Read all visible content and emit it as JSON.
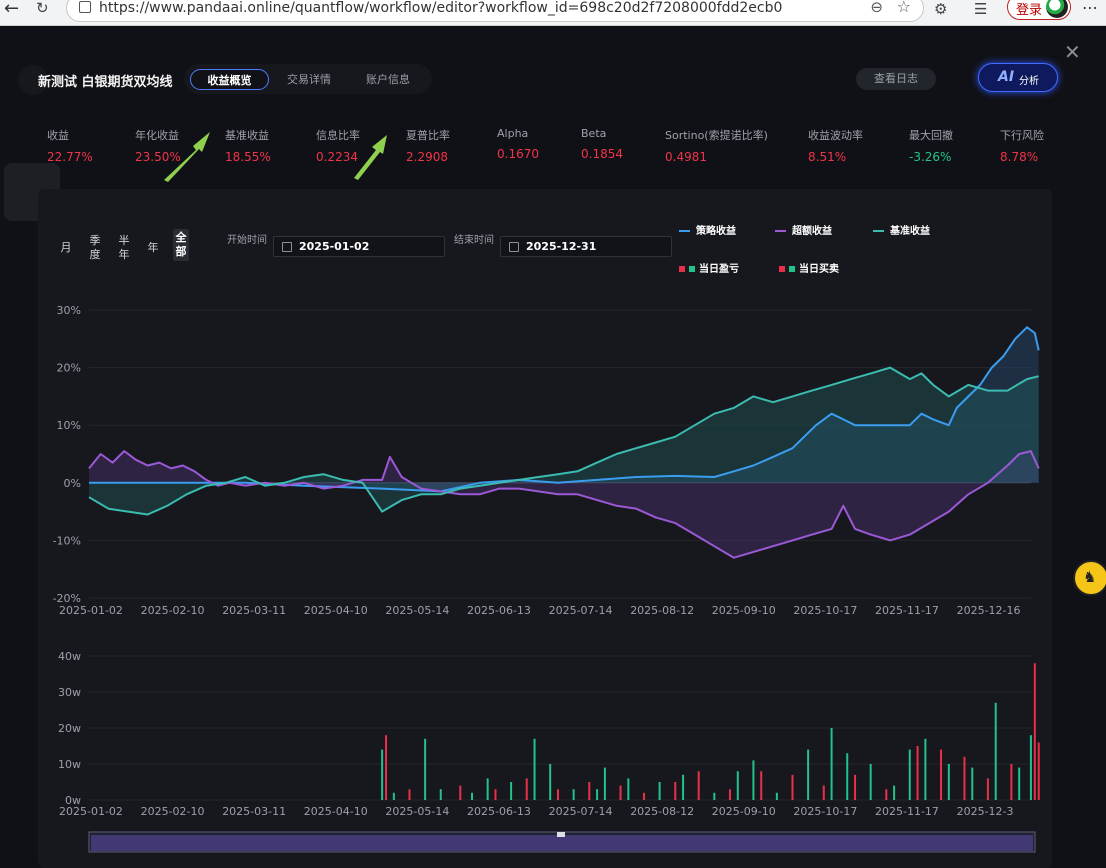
{
  "browser": {
    "url": "https://www.pandaai.online/quantflow/workflow/editor?workflow_id=698c20d2f7208000fdd2ecb0",
    "login_label": "登录"
  },
  "header": {
    "title": "新测试 白银期货双均线",
    "tabs": [
      "收益概览",
      "交易详情",
      "账户信息"
    ],
    "active_tab": "收益概览",
    "log_button": "查看日志",
    "ai_badge": "AI",
    "ai_button": "分析"
  },
  "metrics": [
    {
      "label": "收益",
      "value": "22.77%",
      "color": "#f0344a"
    },
    {
      "label": "年化收益",
      "value": "23.50%",
      "color": "#f0344a"
    },
    {
      "label": "基准收益",
      "value": "18.55%",
      "color": "#f0344a"
    },
    {
      "label": "信息比率",
      "value": "0.2234",
      "color": "#f0344a"
    },
    {
      "label": "夏普比率",
      "value": "2.2908",
      "color": "#f0344a"
    },
    {
      "label": "Alpha",
      "value": "0.1670",
      "color": "#f0344a"
    },
    {
      "label": "Beta",
      "value": "0.1854",
      "color": "#f0344a"
    },
    {
      "label": "Sortino(索提诺比率)",
      "value": "0.4981",
      "color": "#f0344a"
    },
    {
      "label": "收益波动率",
      "value": "8.51%",
      "color": "#f0344a"
    },
    {
      "label": "最大回撤",
      "value": "-3.26%",
      "color": "#26c488"
    },
    {
      "label": "下行风险",
      "value": "8.78%",
      "color": "#f0344a"
    }
  ],
  "filters": {
    "periods": [
      "月",
      "季度",
      "半年",
      "年",
      "全部"
    ],
    "active_period": "全部",
    "start_label": "开始时间",
    "start_value": "2025-01-02",
    "end_label": "结束时间",
    "end_value": "2025-12-31"
  },
  "legend": {
    "strategy": {
      "label": "策略收益",
      "color": "#3a9df0"
    },
    "excess": {
      "label": "超额收益",
      "color": "#9b59d6"
    },
    "benchmark": {
      "label": "基准收益",
      "color": "#3bbcb0"
    },
    "daily_pnl": {
      "label": "当日盈亏"
    },
    "daily_trade": {
      "label": "当日买卖"
    },
    "up_color": "#e8304a",
    "down_color": "#22c28a"
  },
  "chart_data": [
    {
      "type": "line",
      "x_ticks": [
        "2025-01-02",
        "2025-02-10",
        "2025-03-11",
        "2025-04-10",
        "2025-05-14",
        "2025-06-13",
        "2025-07-14",
        "2025-08-12",
        "2025-09-10",
        "2025-10-17",
        "2025-11-17",
        "2025-12-16"
      ],
      "y_ticks": [
        "30%",
        "20%",
        "10%",
        "0%",
        "-10%",
        "-20%"
      ],
      "ylim": [
        -20,
        30
      ],
      "x_index_range": [
        0,
        240
      ],
      "series": [
        {
          "name": "策略收益",
          "color": "#3a9df0",
          "points": [
            [
              0,
              0
            ],
            [
              40,
              0
            ],
            [
              55,
              -0.5
            ],
            [
              75,
              -1
            ],
            [
              90,
              -1.5
            ],
            [
              100,
              0
            ],
            [
              110,
              0.5
            ],
            [
              120,
              0
            ],
            [
              130,
              0.5
            ],
            [
              140,
              1
            ],
            [
              150,
              1.2
            ],
            [
              160,
              1
            ],
            [
              165,
              2
            ],
            [
              170,
              3
            ],
            [
              175,
              4.5
            ],
            [
              180,
              6
            ],
            [
              183,
              8
            ],
            [
              186,
              10
            ],
            [
              190,
              12
            ],
            [
              193,
              11
            ],
            [
              196,
              10
            ],
            [
              200,
              10
            ],
            [
              205,
              10
            ],
            [
              210,
              10
            ],
            [
              213,
              12
            ],
            [
              216,
              11
            ],
            [
              220,
              10
            ],
            [
              222,
              13
            ],
            [
              225,
              15
            ],
            [
              228,
              17
            ],
            [
              231,
              20
            ],
            [
              234,
              22
            ],
            [
              237,
              25
            ],
            [
              240,
              27
            ],
            [
              242,
              26
            ],
            [
              243,
              23
            ]
          ]
        },
        {
          "name": "超额收益",
          "color": "#9b59d6",
          "points": [
            [
              0,
              2.5
            ],
            [
              3,
              5
            ],
            [
              6,
              3.5
            ],
            [
              9,
              5.5
            ],
            [
              12,
              4
            ],
            [
              15,
              3
            ],
            [
              18,
              3.5
            ],
            [
              21,
              2.5
            ],
            [
              24,
              3
            ],
            [
              27,
              2
            ],
            [
              30,
              0.5
            ],
            [
              33,
              -0.5
            ],
            [
              36,
              0
            ],
            [
              40,
              -0.5
            ],
            [
              45,
              0
            ],
            [
              50,
              -0.5
            ],
            [
              55,
              0
            ],
            [
              60,
              -1
            ],
            [
              65,
              -0.5
            ],
            [
              70,
              0.5
            ],
            [
              75,
              0.5
            ],
            [
              77,
              4.5
            ],
            [
              80,
              1
            ],
            [
              85,
              -1
            ],
            [
              90,
              -1.5
            ],
            [
              95,
              -2
            ],
            [
              100,
              -2
            ],
            [
              105,
              -1
            ],
            [
              110,
              -1
            ],
            [
              115,
              -1.5
            ],
            [
              120,
              -2
            ],
            [
              125,
              -2
            ],
            [
              130,
              -3
            ],
            [
              135,
              -4
            ],
            [
              140,
              -4.5
            ],
            [
              145,
              -6
            ],
            [
              150,
              -7
            ],
            [
              155,
              -9
            ],
            [
              160,
              -11
            ],
            [
              165,
              -13
            ],
            [
              170,
              -12
            ],
            [
              175,
              -11
            ],
            [
              180,
              -10
            ],
            [
              185,
              -9
            ],
            [
              190,
              -8
            ],
            [
              193,
              -4
            ],
            [
              196,
              -8
            ],
            [
              200,
              -9
            ],
            [
              205,
              -10
            ],
            [
              210,
              -9
            ],
            [
              215,
              -7
            ],
            [
              220,
              -5
            ],
            [
              225,
              -2
            ],
            [
              230,
              0
            ],
            [
              235,
              3
            ],
            [
              238,
              5
            ],
            [
              241,
              5.5
            ],
            [
              243,
              2.5
            ]
          ]
        },
        {
          "name": "基准收益",
          "color": "#3bbcb0",
          "points": [
            [
              0,
              -2.5
            ],
            [
              5,
              -4.5
            ],
            [
              10,
              -5
            ],
            [
              15,
              -5.5
            ],
            [
              20,
              -4
            ],
            [
              25,
              -2
            ],
            [
              30,
              -0.5
            ],
            [
              35,
              0
            ],
            [
              40,
              1
            ],
            [
              45,
              -0.5
            ],
            [
              50,
              0
            ],
            [
              55,
              1
            ],
            [
              60,
              1.5
            ],
            [
              65,
              0.5
            ],
            [
              70,
              0
            ],
            [
              75,
              -5
            ],
            [
              80,
              -3
            ],
            [
              85,
              -2
            ],
            [
              90,
              -2
            ],
            [
              95,
              -1
            ],
            [
              100,
              -0.5
            ],
            [
              105,
              0
            ],
            [
              110,
              0.5
            ],
            [
              115,
              1
            ],
            [
              120,
              1.5
            ],
            [
              125,
              2
            ],
            [
              130,
              3.5
            ],
            [
              135,
              5
            ],
            [
              140,
              6
            ],
            [
              145,
              7
            ],
            [
              150,
              8
            ],
            [
              155,
              10
            ],
            [
              160,
              12
            ],
            [
              165,
              13
            ],
            [
              170,
              15
            ],
            [
              175,
              14
            ],
            [
              180,
              15
            ],
            [
              185,
              16
            ],
            [
              190,
              17
            ],
            [
              195,
              18
            ],
            [
              200,
              19
            ],
            [
              205,
              20
            ],
            [
              210,
              18
            ],
            [
              213,
              19
            ],
            [
              216,
              17
            ],
            [
              220,
              15
            ],
            [
              225,
              17
            ],
            [
              230,
              16
            ],
            [
              235,
              16
            ],
            [
              240,
              18
            ],
            [
              243,
              18.5
            ]
          ]
        }
      ]
    },
    {
      "type": "bar",
      "y_ticks": [
        "40w",
        "30w",
        "20w",
        "10w",
        "0w"
      ],
      "ylim": [
        0,
        40
      ],
      "x_ticks": [
        "2025-01-02",
        "2025-02-10",
        "2025-03-11",
        "2025-04-10",
        "2025-05-14",
        "2025-06-13",
        "2025-07-14",
        "2025-08-12",
        "2025-09-10",
        "2025-10-17",
        "2025-11-17",
        "2025-12-3"
      ],
      "series": [
        {
          "name": "当日盈亏",
          "color": "#e8304a",
          "points": [
            [
              76,
              18
            ],
            [
              82,
              3
            ],
            [
              95,
              4
            ],
            [
              104,
              3
            ],
            [
              112,
              6
            ],
            [
              120,
              3
            ],
            [
              128,
              5
            ],
            [
              136,
              4
            ],
            [
              142,
              2
            ],
            [
              150,
              5
            ],
            [
              156,
              8
            ],
            [
              164,
              3
            ],
            [
              172,
              8
            ],
            [
              180,
              7
            ],
            [
              188,
              4
            ],
            [
              196,
              7
            ],
            [
              204,
              3
            ],
            [
              212,
              15
            ],
            [
              218,
              14
            ],
            [
              224,
              12
            ],
            [
              230,
              6
            ],
            [
              236,
              10
            ],
            [
              242,
              38
            ],
            [
              243,
              16
            ]
          ]
        },
        {
          "name": "当日买卖",
          "color": "#22c28a",
          "points": [
            [
              75,
              14
            ],
            [
              78,
              2
            ],
            [
              86,
              17
            ],
            [
              90,
              3
            ],
            [
              98,
              2
            ],
            [
              102,
              6
            ],
            [
              108,
              5
            ],
            [
              114,
              17
            ],
            [
              118,
              10
            ],
            [
              124,
              3
            ],
            [
              130,
              3
            ],
            [
              132,
              9
            ],
            [
              138,
              6
            ],
            [
              146,
              5
            ],
            [
              152,
              7
            ],
            [
              160,
              2
            ],
            [
              166,
              8
            ],
            [
              170,
              11
            ],
            [
              176,
              2
            ],
            [
              184,
              14
            ],
            [
              190,
              20
            ],
            [
              194,
              13
            ],
            [
              200,
              10
            ],
            [
              206,
              4
            ],
            [
              210,
              14
            ],
            [
              214,
              17
            ],
            [
              220,
              10
            ],
            [
              226,
              9
            ],
            [
              232,
              27
            ],
            [
              238,
              9
            ],
            [
              241,
              18
            ]
          ]
        }
      ]
    }
  ]
}
